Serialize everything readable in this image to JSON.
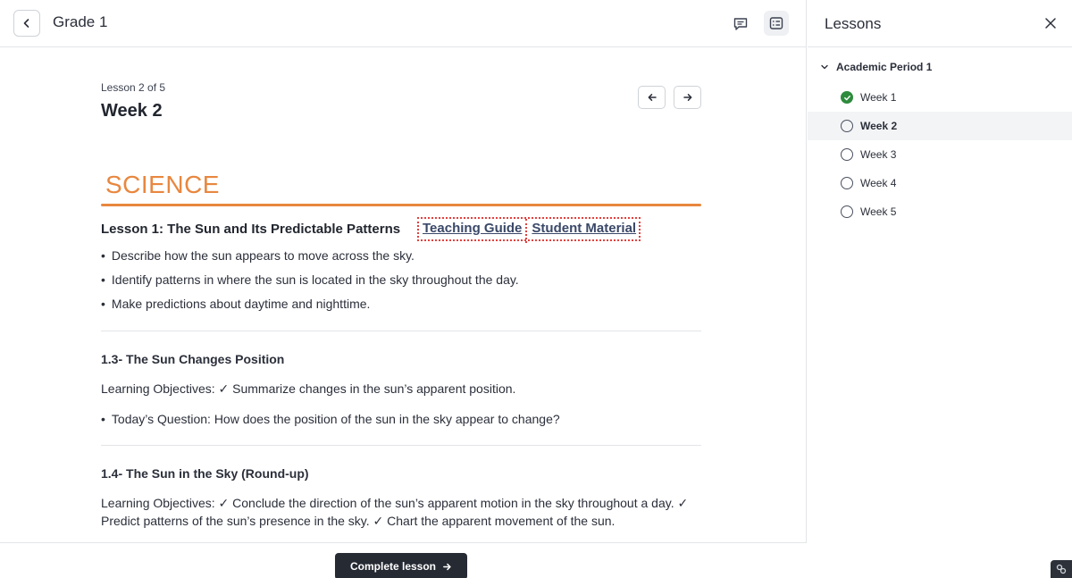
{
  "topbar": {
    "title": "Grade 1",
    "back_icon": "chevron-left-icon",
    "comment_icon": "comment-icon",
    "lessons_toggle_icon": "checklist-icon"
  },
  "lesson": {
    "count_label": "Lesson 2 of 5",
    "title": "Week 2",
    "prev_icon": "arrow-left-icon",
    "next_icon": "arrow-right-icon"
  },
  "content": {
    "subject": "SCIENCE",
    "subject_color": "#e8873f",
    "lesson1": {
      "title": "Lesson 1: The Sun and Its Predictable Patterns",
      "teaching_guide": "Teaching Guide",
      "student_material": "Student Material",
      "bullets": [
        "Describe how the sun appears to move across the sky.",
        "Identify patterns in where the sun is located in the sky throughout the day.",
        "Make predictions about daytime and nighttime."
      ]
    },
    "section13": {
      "title": "1.3- The Sun Changes Position",
      "objectives": "Learning Objectives:  ✓  Summarize changes in the sun’s apparent position.",
      "bullet": "Today’s Question: How does the position of the sun in the sky appear to change?"
    },
    "section14": {
      "title": "1.4- The Sun in the Sky (Round-up)",
      "objectives_line1": "Learning Objectives:  ✓ Conclude the direction of the sun’s apparent  motion in the sky throughout a day. ✓",
      "objectives_line2": "Predict patterns of the sun’s presence in the sky.  ✓ Chart the apparent movement of the sun."
    }
  },
  "footer": {
    "complete_label": "Complete lesson",
    "complete_icon": "arrow-right-icon"
  },
  "sidebar": {
    "title": "Lessons",
    "close_icon": "close-icon",
    "period": "Academic Period 1",
    "weeks": [
      {
        "label": "Week 1",
        "status": "completed"
      },
      {
        "label": "Week 2",
        "status": "current"
      },
      {
        "label": "Week 3",
        "status": "not-started"
      },
      {
        "label": "Week 4",
        "status": "not-started"
      },
      {
        "label": "Week 5",
        "status": "not-started"
      }
    ],
    "complete_color": "#2e8b3d"
  }
}
